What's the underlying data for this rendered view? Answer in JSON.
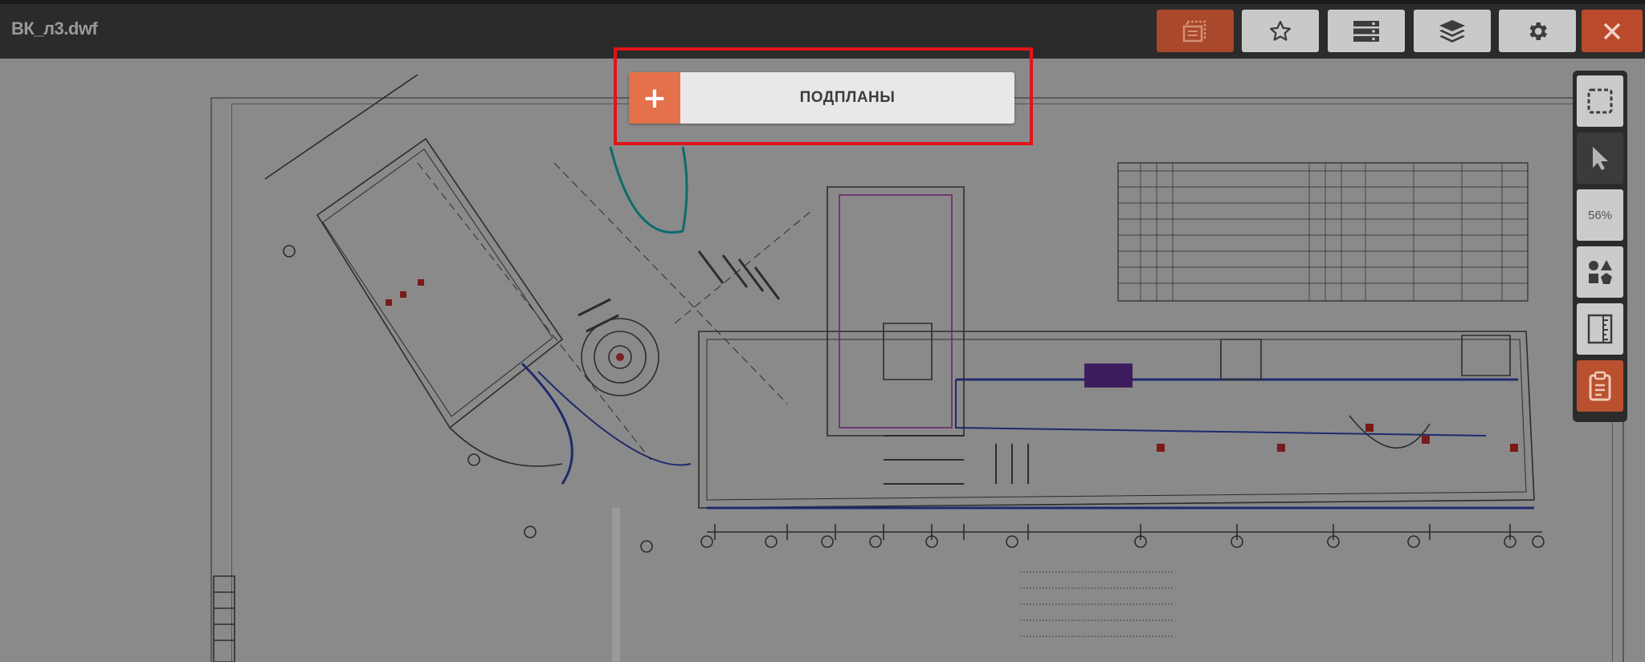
{
  "window": {
    "title": "ВК_л3.dwf"
  },
  "toolbar": {
    "buttons": [
      {
        "name": "sheets-button",
        "icon": "sheets-icon",
        "state": "active"
      },
      {
        "name": "favorites-button",
        "icon": "star-icon",
        "state": "normal"
      },
      {
        "name": "list-button",
        "icon": "list-icon",
        "state": "normal"
      },
      {
        "name": "layers-button",
        "icon": "layers-icon",
        "state": "normal"
      },
      {
        "name": "settings-button",
        "icon": "gear-icon",
        "state": "normal"
      },
      {
        "name": "close-button",
        "icon": "close-icon",
        "state": "danger"
      }
    ]
  },
  "subplans": {
    "add_symbol": "+",
    "label": "ПОДПЛАНЫ"
  },
  "right_toolbar": {
    "zoom": "56%",
    "tools": [
      {
        "name": "select-area-button",
        "icon": "marquee-icon"
      },
      {
        "name": "pointer-button",
        "icon": "cursor-icon",
        "state": "active"
      },
      {
        "name": "zoom-level",
        "icon": "zoom-text"
      },
      {
        "name": "shapes-button",
        "icon": "shapes-icon"
      },
      {
        "name": "ruler-button",
        "icon": "ruler-icon"
      },
      {
        "name": "clipboard-button",
        "icon": "clipboard-icon",
        "state": "highlighted"
      }
    ]
  },
  "colors": {
    "accent": "#e4714a",
    "active_toolbar": "#a9482a",
    "close": "#b94a2c",
    "highlight_frame": "#e0151b",
    "topbar": "#2b2b2b"
  }
}
